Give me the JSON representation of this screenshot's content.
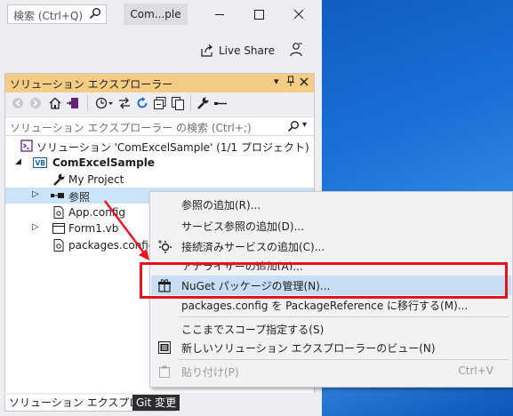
{
  "titlebar": {
    "search_placeholder": "検索 (Ctrl+Q)",
    "window_title": "Com...ple",
    "live_share": "Live Share"
  },
  "panel": {
    "title": "ソリューション エクスプローラー",
    "search_placeholder": "ソリューション エクスプローラー の検索 (Ctrl+;)"
  },
  "tree": {
    "solution": "ソリューション 'ComExcelSample' (1/1 プロジェクト)",
    "project": "ComExcelSample",
    "my_project": "My Project",
    "references": "参照",
    "app_config": "App.config",
    "form1": "Form1.vb",
    "packages_config": "packages.config"
  },
  "bottom_tabs": {
    "solution_explorer": "ソリューション エクスプローラー",
    "git_changes": "Git 変更"
  },
  "context_menu": {
    "items": [
      {
        "label": "参照の追加(R)..."
      },
      {
        "label": "サービス参照の追加(D)..."
      },
      {
        "label": "接続済みサービスの追加(C)..."
      },
      {
        "label": "アナライザーの追加(A)..."
      },
      {
        "label": "NuGet パッケージの管理(N)..."
      },
      {
        "label": "packages.config を PackageReference に移行する(M)..."
      },
      {
        "label": "ここまでスコープ指定する(S)"
      },
      {
        "label": "新しいソリューション エクスプローラーのビュー(N)"
      },
      {
        "label": "貼り付け(P)",
        "shortcut": "Ctrl+V"
      }
    ]
  },
  "colors": {
    "panel_header": "#f5cc84",
    "highlight": "#e8101a",
    "selection": "#cce4f7",
    "vs_purple": "#68217a"
  }
}
